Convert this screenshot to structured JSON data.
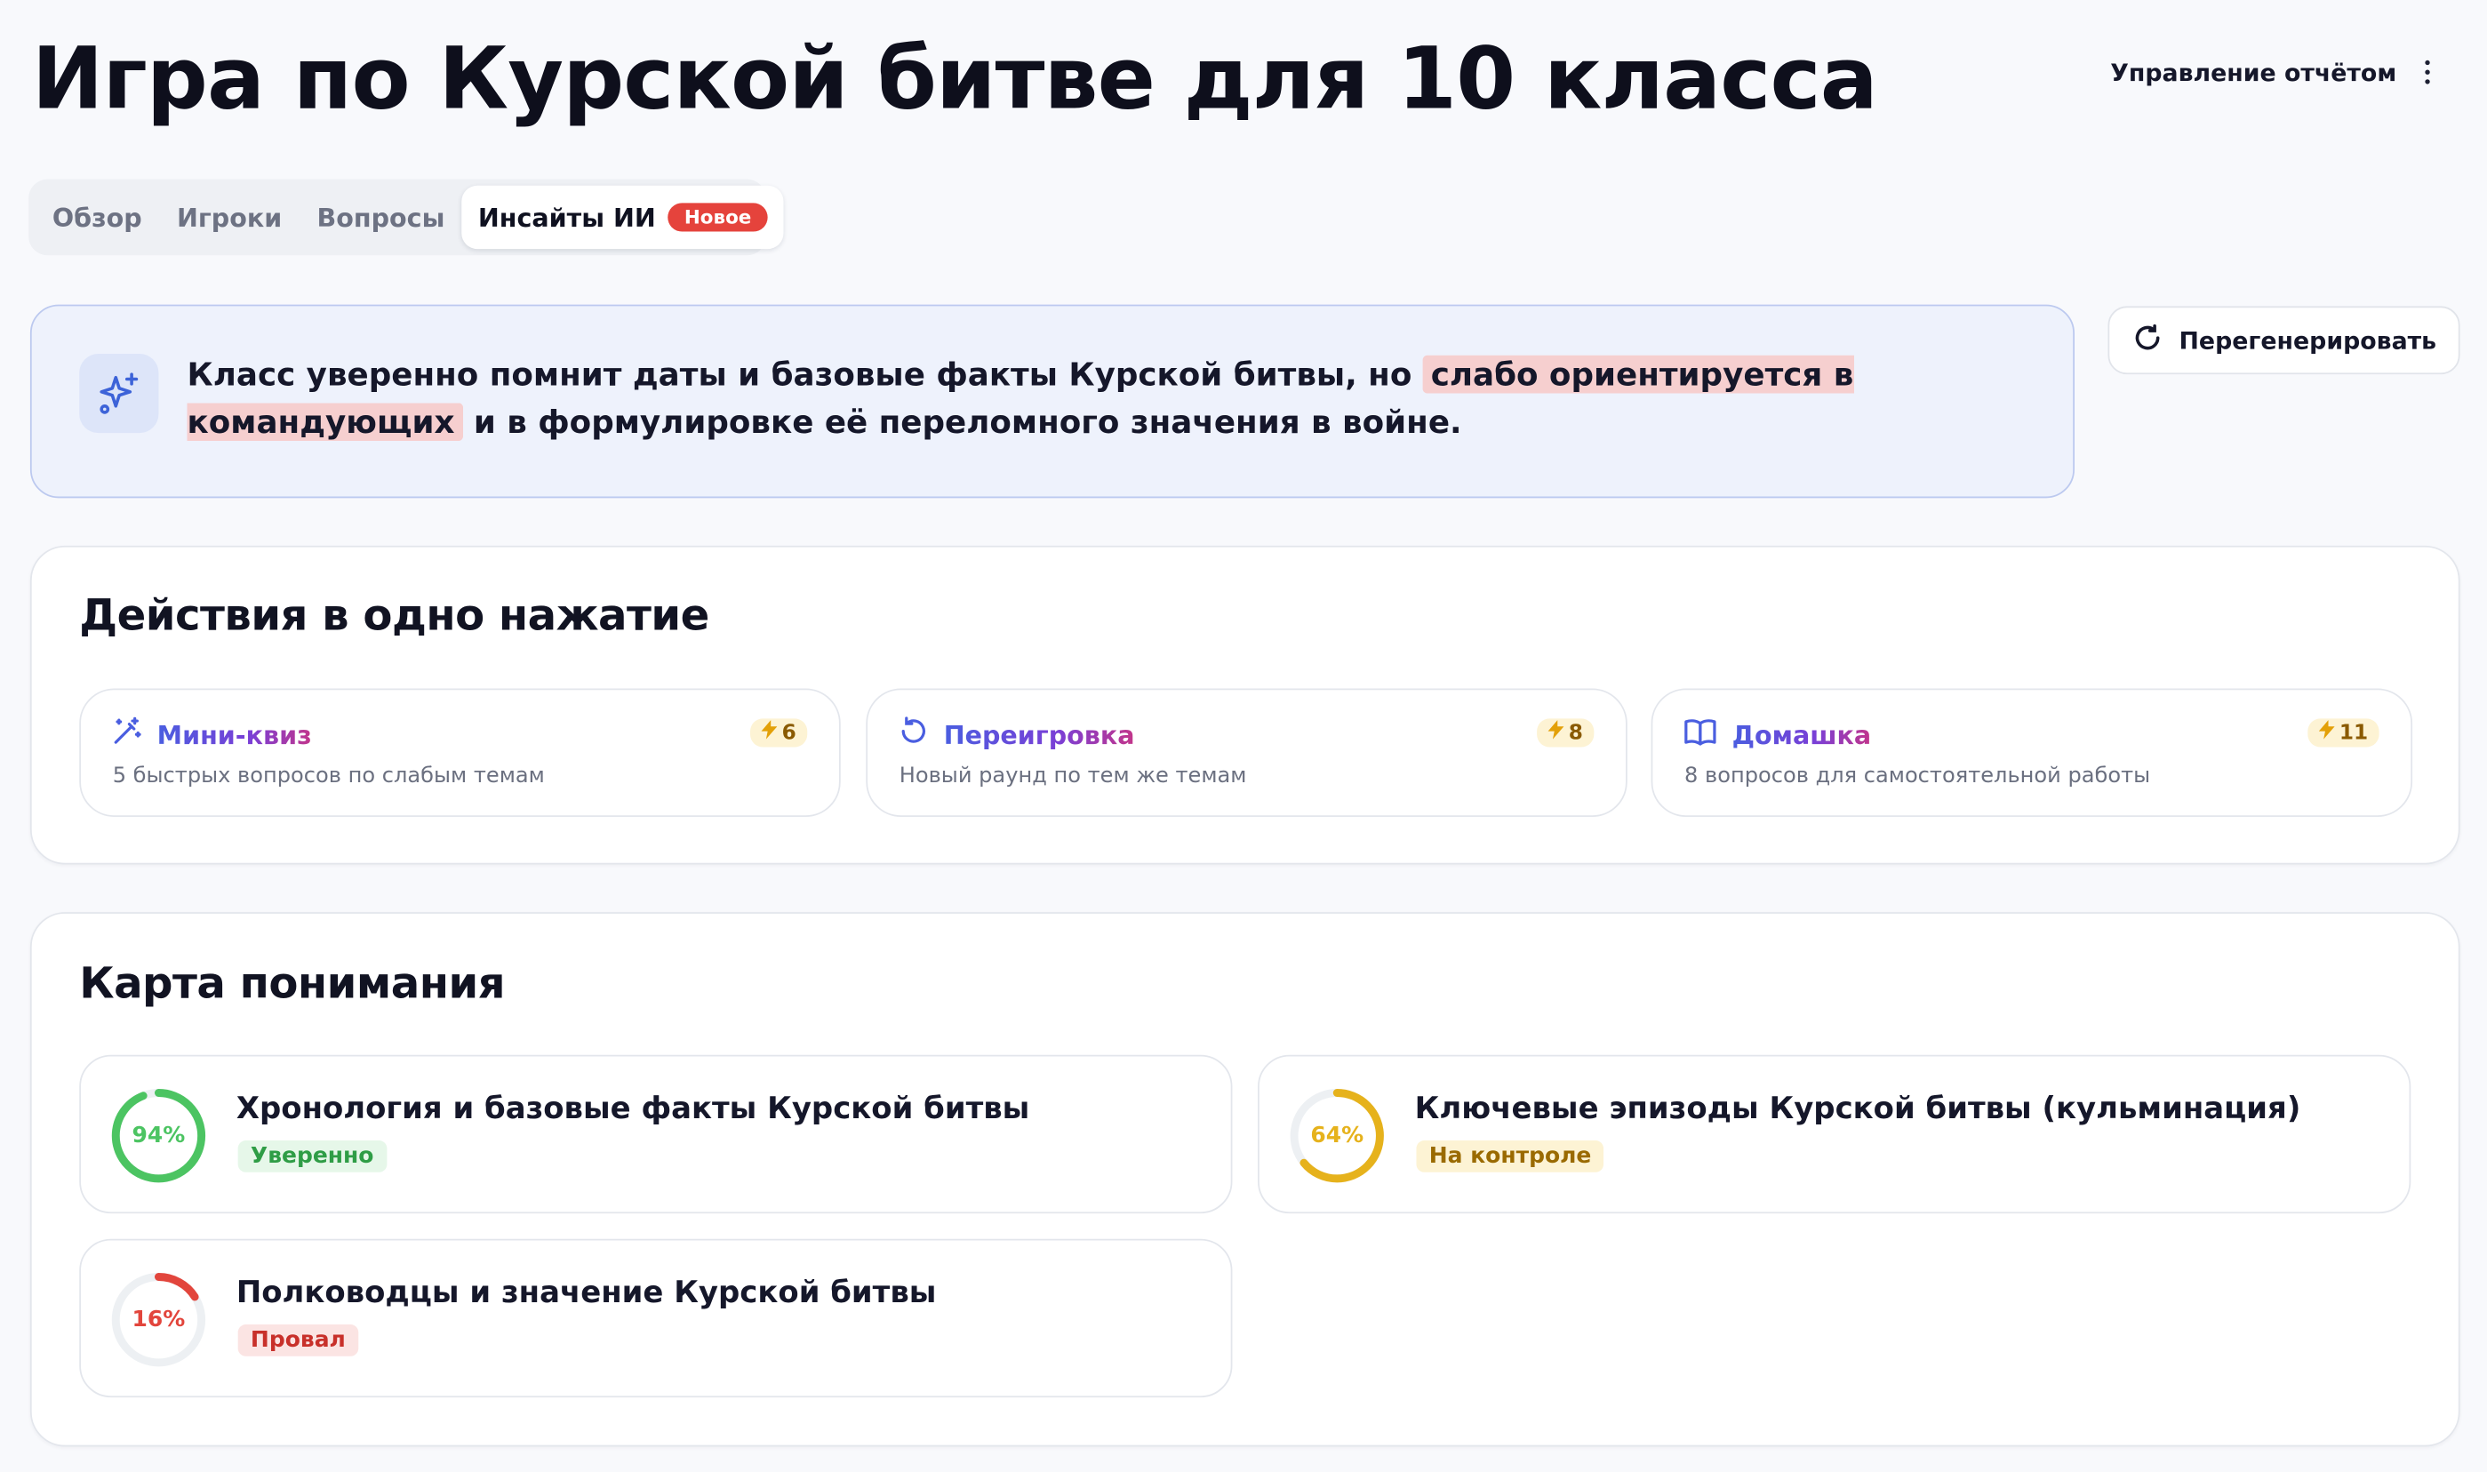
{
  "header": {
    "title": "Игра по Курской битве для 10 класса",
    "report_menu_label": "Управление отчётом"
  },
  "tabs": [
    {
      "label": "Обзор"
    },
    {
      "label": "Игроки"
    },
    {
      "label": "Вопросы"
    },
    {
      "label": "Инсайты ИИ",
      "badge": "Новое",
      "active": true
    }
  ],
  "insight": {
    "text_before": "Класс уверенно помнит даты и базовые факты Курской битвы, но ",
    "highlight": "слабо ориентируется в командующих",
    "text_after": " и в формулировке её переломного значения в войне."
  },
  "regenerate_label": "Перегенерировать",
  "actions": {
    "title": "Действия в одно нажатие",
    "items": [
      {
        "title": "Мини-квиз",
        "desc": "5 быстрых вопросов по слабым темам",
        "cost": "6",
        "icon": "magic-wand-icon"
      },
      {
        "title": "Переигровка",
        "desc": "Новый раунд по тем же темам",
        "cost": "8",
        "icon": "replay-icon"
      },
      {
        "title": "Домашка",
        "desc": "8 вопросов для самостоятельной работы",
        "cost": "11",
        "icon": "book-icon"
      }
    ]
  },
  "understanding": {
    "title": "Карта понимания",
    "topics": [
      {
        "name": "Хронология и базовые факты Курской битвы",
        "percent": 94,
        "percent_label": "94%",
        "status": "Уверенно",
        "color": "#4cc462",
        "status_bg": "#e6f7e9",
        "status_color": "#2f9d46"
      },
      {
        "name": "Ключевые эпизоды Курской битвы (кульминация)",
        "percent": 64,
        "percent_label": "64%",
        "status": "На контроле",
        "color": "#e6b21c",
        "status_bg": "#fdf3d4",
        "status_color": "#9a6a00"
      },
      {
        "name": "Полководцы и значение Курской битвы",
        "percent": 16,
        "percent_label": "16%",
        "status": "Провал",
        "color": "#e2453c",
        "status_bg": "#fbe4e3",
        "status_color": "#c8302a"
      }
    ]
  },
  "colors": {
    "accent": "#4a5ee0",
    "danger": "#e5433c",
    "insight_bg": "#eef2fc",
    "highlight": "#f6cfcf"
  }
}
